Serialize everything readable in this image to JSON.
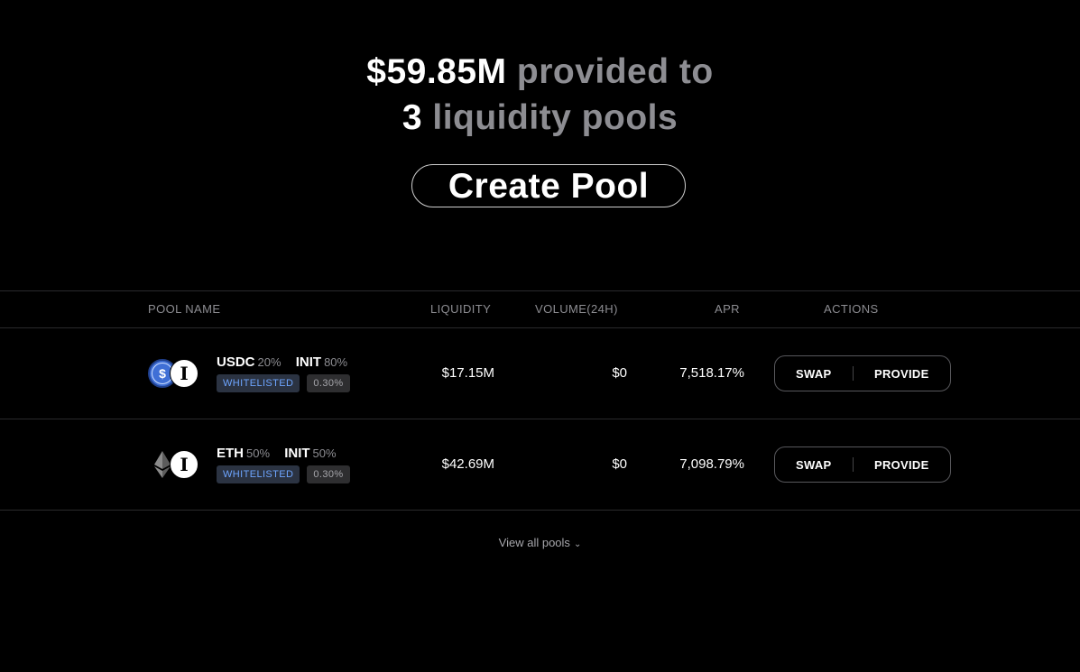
{
  "hero": {
    "amount": "$59.85M",
    "provided_text": "provided to",
    "pool_count": "3",
    "pools_text": "liquidity pools"
  },
  "create_pool_label": "Create Pool",
  "table": {
    "headers": {
      "pool_name": "POOL NAME",
      "liquidity": "LIQUIDITY",
      "volume": "VOLUME(24H)",
      "apr": "APR",
      "actions": "ACTIONS"
    },
    "rows": [
      {
        "token1": "USDC",
        "token1_pct": "20%",
        "token2": "INIT",
        "token2_pct": "80%",
        "token1_icon": "usdc-icon",
        "token2_icon": "init-icon",
        "badge_whitelisted": "WHITELISTED",
        "fee": "0.30%",
        "liquidity": "$17.15M",
        "volume": "$0",
        "apr": "7,518.17%",
        "swap_label": "SWAP",
        "provide_label": "PROVIDE"
      },
      {
        "token1": "ETH",
        "token1_pct": "50%",
        "token2": "INIT",
        "token2_pct": "50%",
        "token1_icon": "eth-icon",
        "token2_icon": "init-icon",
        "badge_whitelisted": "WHITELISTED",
        "fee": "0.30%",
        "liquidity": "$42.69M",
        "volume": "$0",
        "apr": "7,098.79%",
        "swap_label": "SWAP",
        "provide_label": "PROVIDE"
      }
    ]
  },
  "view_all_label": "View all pools",
  "colors": {
    "background": "#000000",
    "muted_text": "#8d8d92",
    "whitelisted_text": "#6ea5ff",
    "usdc_blue": "#3f6fd6"
  }
}
